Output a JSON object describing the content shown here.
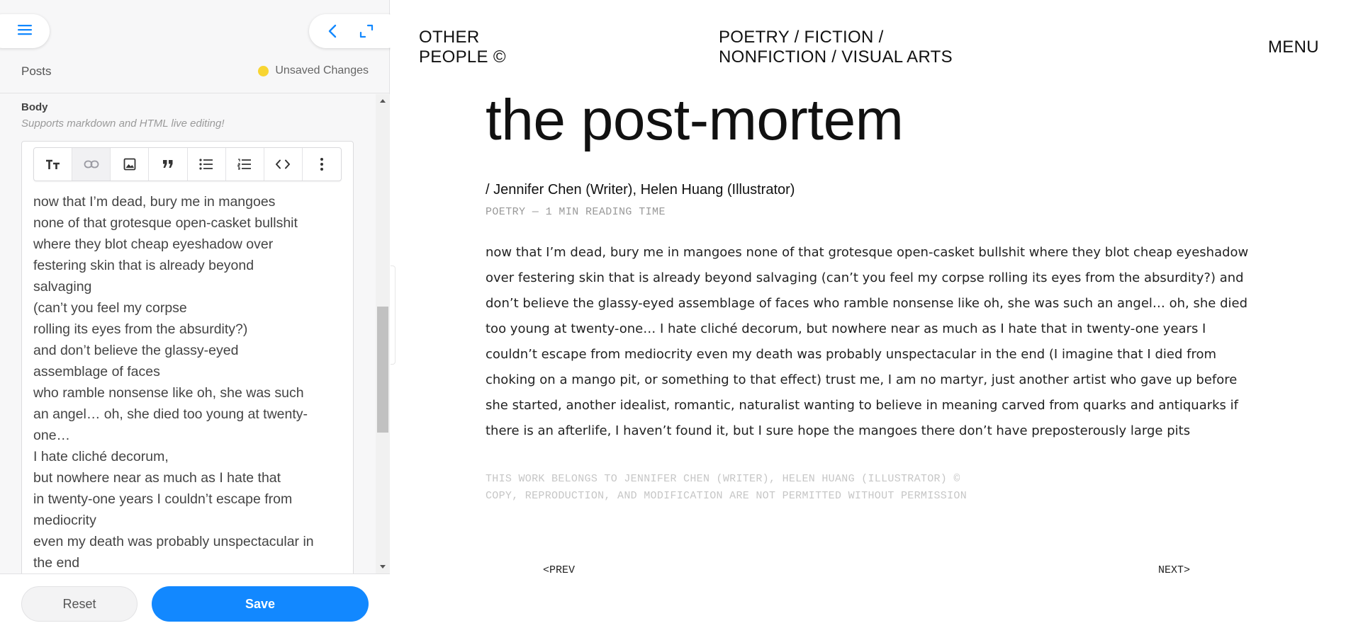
{
  "editor": {
    "header": {
      "posts_label": "Posts",
      "status_text": "Unsaved Changes",
      "status_color": "#f8d532"
    },
    "fab_icons": [
      "hamburger-icon",
      "chevron-left-icon",
      "expand-icon"
    ],
    "body_field": {
      "label": "Body",
      "hint": "Supports markdown and HTML live editing!",
      "toolbar_icons": [
        "text-size-icon",
        "link-icon",
        "image-icon",
        "quote-icon",
        "bullet-list-icon",
        "numbered-list-icon",
        "code-icon",
        "more-icon"
      ],
      "lines": [
        "now that I’m dead, bury me in mangoes",
        "none of that grotesque open-casket bullshit",
        "where they blot cheap eyeshadow over",
        "festering skin that is already beyond",
        "salvaging",
        "(can’t you feel my corpse",
        "rolling its eyes from the absurdity?)",
        "and don’t believe the glassy-eyed",
        "assemblage of faces",
        "who ramble nonsense like oh, she was such",
        "an angel… oh, she died too young at twenty-",
        "one…",
        "I hate cliché decorum,",
        "but nowhere near as much as I hate that",
        "in twenty-one years I couldn’t escape from",
        "mediocrity",
        "even my death was probably unspectacular in",
        "the end"
      ]
    },
    "footer": {
      "reset_label": "Reset",
      "save_label": "Save",
      "save_color": "#1288ff"
    }
  },
  "site": {
    "logo": [
      "OTHER",
      "PEOPLE ©"
    ],
    "categories": [
      "POETRY / FICTION /",
      "NONFICTION / VISUAL ARTS"
    ],
    "menu_label": "MENU",
    "post": {
      "title": "the post-mortem",
      "byline": "/ Jennifer Chen (Writer), Helen Huang (Illustrator)",
      "meta": "POETRY — 1 MIN READING TIME",
      "body": "now that I’m dead, bury me in mangoes none of that grotesque open-casket bullshit where they blot cheap eyeshadow over festering skin that is already beyond salvaging (can’t you feel my corpse rolling its eyes from the absurdity?) and don’t believe the glassy-eyed assemblage of faces who ramble nonsense like oh, she was such an angel… oh, she died too young at twenty-one… I hate cliché decorum, but nowhere near as much as I hate that in twenty-one years I couldn’t escape from mediocrity even my death was probably unspectacular in the end (I imagine that I died from choking on a mango pit, or something to that effect) trust me, I am no martyr, just another artist who gave up before she started, another idealist, romantic, naturalist wanting to believe in meaning carved from quarks and antiquarks if there is an afterlife, I haven’t found it, but I sure hope the mangoes there don’t have preposterously large pits",
      "rights": [
        "THIS WORK BELONGS TO JENNIFER CHEN (WRITER), HELEN HUANG (ILLUSTRATOR) ©",
        "COPY, REPRODUCTION, AND MODIFICATION ARE NOT PERMITTED WITHOUT PERMISSION"
      ]
    },
    "pager": {
      "prev": "<PREV",
      "next": "NEXT>"
    }
  }
}
